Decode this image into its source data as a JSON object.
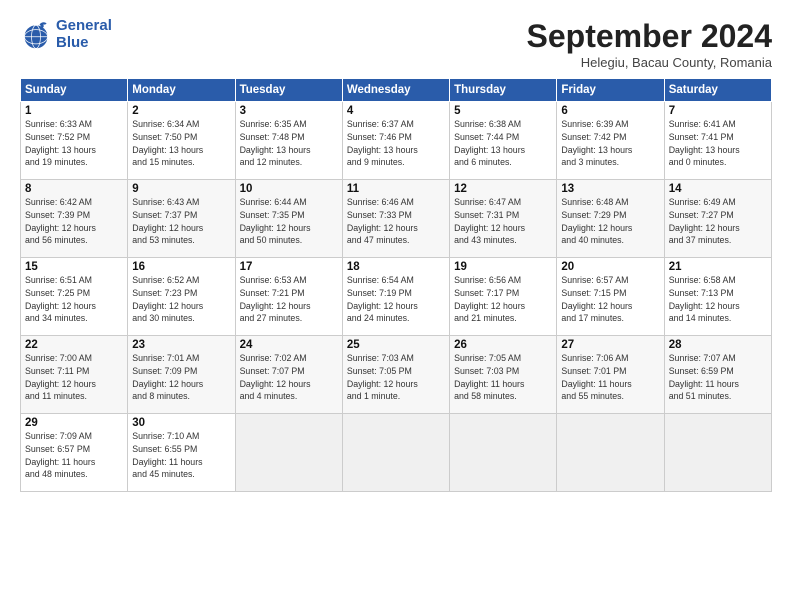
{
  "logo": {
    "line1": "General",
    "line2": "Blue"
  },
  "title": "September 2024",
  "location": "Helegiu, Bacau County, Romania",
  "weekdays": [
    "Sunday",
    "Monday",
    "Tuesday",
    "Wednesday",
    "Thursday",
    "Friday",
    "Saturday"
  ],
  "weeks": [
    [
      {
        "day": "1",
        "info": "Sunrise: 6:33 AM\nSunset: 7:52 PM\nDaylight: 13 hours\nand 19 minutes."
      },
      {
        "day": "2",
        "info": "Sunrise: 6:34 AM\nSunset: 7:50 PM\nDaylight: 13 hours\nand 15 minutes."
      },
      {
        "day": "3",
        "info": "Sunrise: 6:35 AM\nSunset: 7:48 PM\nDaylight: 13 hours\nand 12 minutes."
      },
      {
        "day": "4",
        "info": "Sunrise: 6:37 AM\nSunset: 7:46 PM\nDaylight: 13 hours\nand 9 minutes."
      },
      {
        "day": "5",
        "info": "Sunrise: 6:38 AM\nSunset: 7:44 PM\nDaylight: 13 hours\nand 6 minutes."
      },
      {
        "day": "6",
        "info": "Sunrise: 6:39 AM\nSunset: 7:42 PM\nDaylight: 13 hours\nand 3 minutes."
      },
      {
        "day": "7",
        "info": "Sunrise: 6:41 AM\nSunset: 7:41 PM\nDaylight: 13 hours\nand 0 minutes."
      }
    ],
    [
      {
        "day": "8",
        "info": "Sunrise: 6:42 AM\nSunset: 7:39 PM\nDaylight: 12 hours\nand 56 minutes."
      },
      {
        "day": "9",
        "info": "Sunrise: 6:43 AM\nSunset: 7:37 PM\nDaylight: 12 hours\nand 53 minutes."
      },
      {
        "day": "10",
        "info": "Sunrise: 6:44 AM\nSunset: 7:35 PM\nDaylight: 12 hours\nand 50 minutes."
      },
      {
        "day": "11",
        "info": "Sunrise: 6:46 AM\nSunset: 7:33 PM\nDaylight: 12 hours\nand 47 minutes."
      },
      {
        "day": "12",
        "info": "Sunrise: 6:47 AM\nSunset: 7:31 PM\nDaylight: 12 hours\nand 43 minutes."
      },
      {
        "day": "13",
        "info": "Sunrise: 6:48 AM\nSunset: 7:29 PM\nDaylight: 12 hours\nand 40 minutes."
      },
      {
        "day": "14",
        "info": "Sunrise: 6:49 AM\nSunset: 7:27 PM\nDaylight: 12 hours\nand 37 minutes."
      }
    ],
    [
      {
        "day": "15",
        "info": "Sunrise: 6:51 AM\nSunset: 7:25 PM\nDaylight: 12 hours\nand 34 minutes."
      },
      {
        "day": "16",
        "info": "Sunrise: 6:52 AM\nSunset: 7:23 PM\nDaylight: 12 hours\nand 30 minutes."
      },
      {
        "day": "17",
        "info": "Sunrise: 6:53 AM\nSunset: 7:21 PM\nDaylight: 12 hours\nand 27 minutes."
      },
      {
        "day": "18",
        "info": "Sunrise: 6:54 AM\nSunset: 7:19 PM\nDaylight: 12 hours\nand 24 minutes."
      },
      {
        "day": "19",
        "info": "Sunrise: 6:56 AM\nSunset: 7:17 PM\nDaylight: 12 hours\nand 21 minutes."
      },
      {
        "day": "20",
        "info": "Sunrise: 6:57 AM\nSunset: 7:15 PM\nDaylight: 12 hours\nand 17 minutes."
      },
      {
        "day": "21",
        "info": "Sunrise: 6:58 AM\nSunset: 7:13 PM\nDaylight: 12 hours\nand 14 minutes."
      }
    ],
    [
      {
        "day": "22",
        "info": "Sunrise: 7:00 AM\nSunset: 7:11 PM\nDaylight: 12 hours\nand 11 minutes."
      },
      {
        "day": "23",
        "info": "Sunrise: 7:01 AM\nSunset: 7:09 PM\nDaylight: 12 hours\nand 8 minutes."
      },
      {
        "day": "24",
        "info": "Sunrise: 7:02 AM\nSunset: 7:07 PM\nDaylight: 12 hours\nand 4 minutes."
      },
      {
        "day": "25",
        "info": "Sunrise: 7:03 AM\nSunset: 7:05 PM\nDaylight: 12 hours\nand 1 minute."
      },
      {
        "day": "26",
        "info": "Sunrise: 7:05 AM\nSunset: 7:03 PM\nDaylight: 11 hours\nand 58 minutes."
      },
      {
        "day": "27",
        "info": "Sunrise: 7:06 AM\nSunset: 7:01 PM\nDaylight: 11 hours\nand 55 minutes."
      },
      {
        "day": "28",
        "info": "Sunrise: 7:07 AM\nSunset: 6:59 PM\nDaylight: 11 hours\nand 51 minutes."
      }
    ],
    [
      {
        "day": "29",
        "info": "Sunrise: 7:09 AM\nSunset: 6:57 PM\nDaylight: 11 hours\nand 48 minutes."
      },
      {
        "day": "30",
        "info": "Sunrise: 7:10 AM\nSunset: 6:55 PM\nDaylight: 11 hours\nand 45 minutes."
      },
      {
        "day": "",
        "info": ""
      },
      {
        "day": "",
        "info": ""
      },
      {
        "day": "",
        "info": ""
      },
      {
        "day": "",
        "info": ""
      },
      {
        "day": "",
        "info": ""
      }
    ]
  ]
}
